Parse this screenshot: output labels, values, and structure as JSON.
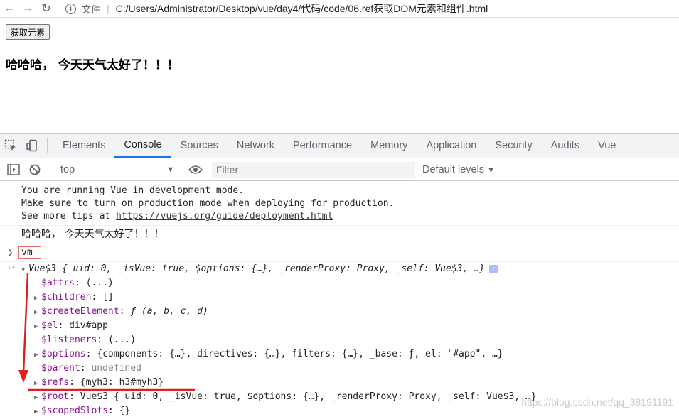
{
  "browser": {
    "file_label": "文件",
    "url": "C:/Users/Administrator/Desktop/vue/day4/代码/code/06.ref获取DOM元素和组件.html"
  },
  "page": {
    "button_label": "获取元素",
    "heading": "哈哈哈， 今天天气太好了！！！"
  },
  "devtools": {
    "tabs": [
      "Elements",
      "Console",
      "Sources",
      "Network",
      "Performance",
      "Memory",
      "Application",
      "Security",
      "Audits",
      "Vue"
    ],
    "active_tab": "Console",
    "context": "top",
    "filter_placeholder": "Filter",
    "levels": "Default levels"
  },
  "console": {
    "vue_info": [
      "You are running Vue in development mode.",
      "Make sure to turn on production mode when deploying for production.",
      "See more tips at "
    ],
    "vue_link": "https://vuejs.org/guide/deployment.html",
    "log_text": "哈哈哈， 今天天气太好了！！！",
    "input": "vm",
    "result_summary": "Vue$3 {_uid: 0, _isVue: true, $options: {…}, _renderProxy: Proxy, _self: Vue$3, …}",
    "props": [
      {
        "expandable": false,
        "key": "$attrs",
        "value": "(...)"
      },
      {
        "expandable": true,
        "key": "$children",
        "value": "[]"
      },
      {
        "expandable": true,
        "key": "$createElement",
        "value": "ƒ (a, b, c, d)"
      },
      {
        "expandable": true,
        "key": "$el",
        "value": "div#app"
      },
      {
        "expandable": false,
        "key": "$listeners",
        "value": "(...)"
      },
      {
        "expandable": true,
        "key": "$options",
        "value": "{components: {…}, directives: {…}, filters: {…}, _base: ƒ, el: \"#app\", …}"
      },
      {
        "expandable": false,
        "key": "$parent",
        "value": "undefined"
      },
      {
        "expandable": true,
        "key": "$refs",
        "value": "{myh3: h3#myh3}"
      },
      {
        "expandable": true,
        "key": "$root",
        "value": "Vue$3 {_uid: 0, _isVue: true, $options: {…}, _renderProxy: Proxy, _self: Vue$3, …}"
      },
      {
        "expandable": true,
        "key": "$scopedSlots",
        "value": "{}"
      }
    ]
  },
  "watermark": "https://blog.csdn.net/qq_38191191",
  "annotation": {
    "color": "#e02020"
  }
}
